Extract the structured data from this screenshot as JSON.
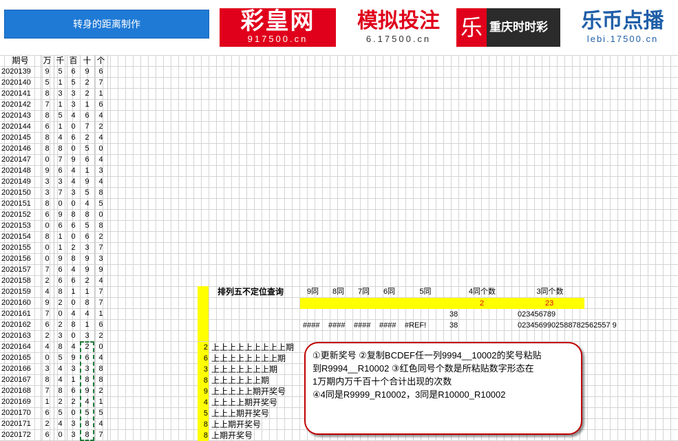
{
  "toolbar": {
    "button_label": "转身的距离制作"
  },
  "logos": {
    "caihuang": {
      "main": "彩皇网",
      "url": "917500.cn"
    },
    "moni": {
      "main": "模拟投注",
      "url": "6.17500.cn"
    },
    "cq": {
      "icon": "乐",
      "main": "重庆时时彩"
    },
    "lebi": {
      "main": "乐币点播",
      "url": "lebi.17500.cn"
    }
  },
  "columns": {
    "period": "期号",
    "wan": "万",
    "qian": "千",
    "bai": "百",
    "shi": "十",
    "ge": "个"
  },
  "rows": [
    {
      "period": "2020139",
      "d": [
        "9",
        "5",
        "6",
        "9",
        "6"
      ]
    },
    {
      "period": "2020140",
      "d": [
        "5",
        "1",
        "5",
        "2",
        "7"
      ]
    },
    {
      "period": "2020141",
      "d": [
        "8",
        "3",
        "3",
        "2",
        "1"
      ]
    },
    {
      "period": "2020142",
      "d": [
        "7",
        "1",
        "3",
        "1",
        "6"
      ]
    },
    {
      "period": "2020143",
      "d": [
        "8",
        "5",
        "4",
        "6",
        "4"
      ]
    },
    {
      "period": "2020144",
      "d": [
        "6",
        "1",
        "0",
        "7",
        "2"
      ]
    },
    {
      "period": "2020145",
      "d": [
        "8",
        "4",
        "6",
        "2",
        "4"
      ]
    },
    {
      "period": "2020146",
      "d": [
        "8",
        "8",
        "0",
        "5",
        "0"
      ]
    },
    {
      "period": "2020147",
      "d": [
        "0",
        "7",
        "9",
        "6",
        "4"
      ]
    },
    {
      "period": "2020148",
      "d": [
        "9",
        "6",
        "4",
        "1",
        "3"
      ]
    },
    {
      "period": "2020149",
      "d": [
        "3",
        "3",
        "4",
        "9",
        "4"
      ]
    },
    {
      "period": "2020150",
      "d": [
        "3",
        "7",
        "3",
        "5",
        "8"
      ]
    },
    {
      "period": "2020151",
      "d": [
        "8",
        "0",
        "0",
        "4",
        "5"
      ]
    },
    {
      "period": "2020152",
      "d": [
        "6",
        "9",
        "8",
        "8",
        "0"
      ]
    },
    {
      "period": "2020153",
      "d": [
        "0",
        "6",
        "6",
        "5",
        "8"
      ]
    },
    {
      "period": "2020154",
      "d": [
        "8",
        "1",
        "0",
        "6",
        "2"
      ]
    },
    {
      "period": "2020155",
      "d": [
        "0",
        "1",
        "2",
        "3",
        "7"
      ]
    },
    {
      "period": "2020156",
      "d": [
        "0",
        "9",
        "8",
        "9",
        "3"
      ]
    },
    {
      "period": "2020157",
      "d": [
        "7",
        "6",
        "4",
        "9",
        "9"
      ]
    },
    {
      "period": "2020158",
      "d": [
        "2",
        "6",
        "6",
        "2",
        "4"
      ]
    },
    {
      "period": "2020159",
      "d": [
        "4",
        "8",
        "1",
        "1",
        "7"
      ]
    },
    {
      "period": "2020160",
      "d": [
        "9",
        "2",
        "0",
        "8",
        "7"
      ]
    },
    {
      "period": "2020161",
      "d": [
        "7",
        "0",
        "4",
        "4",
        "1"
      ]
    },
    {
      "period": "2020162",
      "d": [
        "6",
        "2",
        "8",
        "1",
        "6"
      ]
    },
    {
      "period": "2020163",
      "d": [
        "2",
        "3",
        "0",
        "3",
        "2"
      ]
    },
    {
      "period": "2020164",
      "d": [
        "4",
        "8",
        "4",
        "2",
        "0"
      ]
    },
    {
      "period": "2020165",
      "d": [
        "0",
        "5",
        "9",
        "6",
        "4"
      ]
    },
    {
      "period": "2020166",
      "d": [
        "3",
        "4",
        "3",
        "3",
        "8"
      ]
    },
    {
      "period": "2020167",
      "d": [
        "8",
        "4",
        "1",
        "8",
        "8"
      ]
    },
    {
      "period": "2020168",
      "d": [
        "7",
        "8",
        "6",
        "9",
        "2"
      ]
    },
    {
      "period": "2020169",
      "d": [
        "1",
        "2",
        "2",
        "4",
        "1"
      ]
    },
    {
      "period": "2020170",
      "d": [
        "6",
        "5",
        "0",
        "5",
        "5"
      ]
    },
    {
      "period": "2020171",
      "d": [
        "2",
        "4",
        "3",
        "8",
        "4"
      ]
    },
    {
      "period": "2020172",
      "d": [
        "6",
        "0",
        "3",
        "8",
        "7"
      ]
    }
  ],
  "query": {
    "title": "排列五不定位查询",
    "headers": [
      "9同",
      "8同",
      "7同",
      "6同",
      "5同",
      "4同个数",
      "3同个数"
    ],
    "red_4": "2",
    "red_3": "23",
    "row161_4": "38",
    "row161_3": "023456789",
    "row162_h": [
      "####",
      "####",
      "####",
      "####",
      "#REF!"
    ],
    "row162_4": "38",
    "row162_3": "0234569902588782562557 9"
  },
  "labels": [
    {
      "n": "2",
      "t": "上上上上上上上上上期"
    },
    {
      "n": "6",
      "t": "上上上上上上上上期"
    },
    {
      "n": "3",
      "t": "上上上上上上上期"
    },
    {
      "n": "8",
      "t": "上上上上上上期"
    },
    {
      "n": "9",
      "t": "上上上上上期开奖号"
    },
    {
      "n": "4",
      "t": "上上上上期开奖号"
    },
    {
      "n": "5",
      "t": "上上上期开奖号"
    },
    {
      "n": "8",
      "t": "上上期开奖号"
    },
    {
      "n": "8",
      "t": "上期开奖号"
    }
  ],
  "annotation": {
    "line1": "①更新奖号    ②复制BCDEF任一列9994__10002的奖号粘贴",
    "line2": "到R9994__R10002          ③红色同号个数是所粘贴数字形态在",
    "line3": "1万期内万千百十个合计出现的次数",
    "line4": "④4同是R9999_R10002，3同是R10000_R10002"
  },
  "colors": {
    "accent": "#1f7ad6",
    "red": "#e0001b",
    "highlight": "#ffff00"
  }
}
